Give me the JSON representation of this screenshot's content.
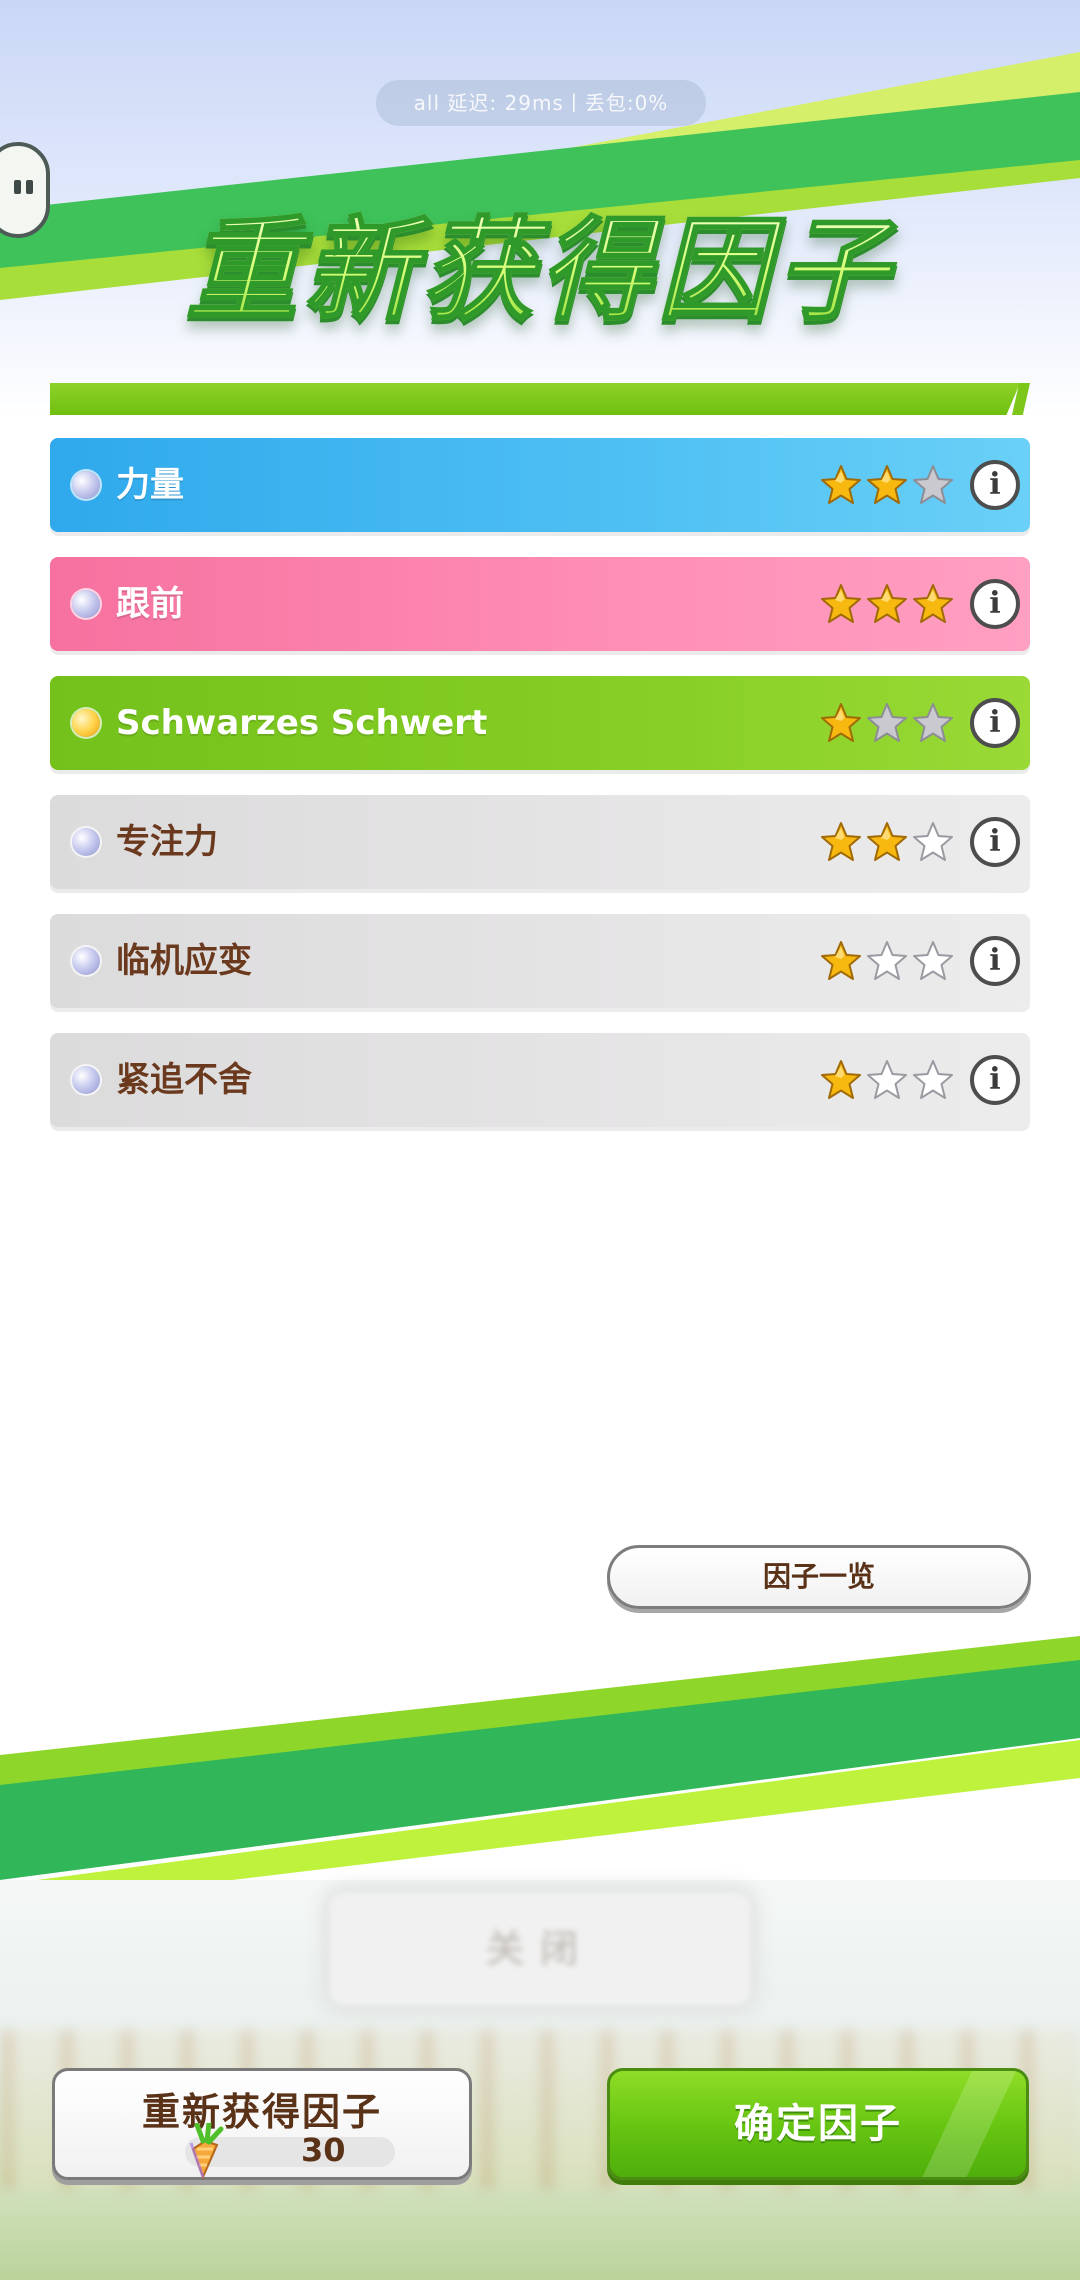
{
  "status": {
    "text": "all 延迟: 29ms丨丢包:0%"
  },
  "header": {
    "title": "重新获得因子"
  },
  "factors": [
    {
      "name": "力量",
      "color": "blue",
      "dot": "silver",
      "stars": 2,
      "max_stars": 3
    },
    {
      "name": "跟前",
      "color": "pink",
      "dot": "silver",
      "stars": 3,
      "max_stars": 3
    },
    {
      "name": "Schwarzes Schwert",
      "color": "green",
      "dot": "gold",
      "stars": 1,
      "max_stars": 3
    },
    {
      "name": "专注力",
      "color": "gray",
      "dot": "silver",
      "stars": 2,
      "max_stars": 3
    },
    {
      "name": "临机应变",
      "color": "gray",
      "dot": "silver",
      "stars": 1,
      "max_stars": 3
    },
    {
      "name": "紧追不舍",
      "color": "gray",
      "dot": "silver",
      "stars": 1,
      "max_stars": 3
    }
  ],
  "info_label": "i",
  "factor_list_button": {
    "label": "因子一览"
  },
  "background_close": {
    "label": "关闭"
  },
  "footer": {
    "reacquire_label": "重新获得因子",
    "cost": "30",
    "confirm_label": "确定因子"
  },
  "colors": {
    "accent_green": "#6fbf10",
    "row_blue": "#4fc0f3",
    "row_pink": "#ff8fb7",
    "row_green": "#86cf24",
    "row_gray": "#e6e5e6",
    "star_gold": "#f7b80f",
    "text_brown": "#5a3218"
  }
}
